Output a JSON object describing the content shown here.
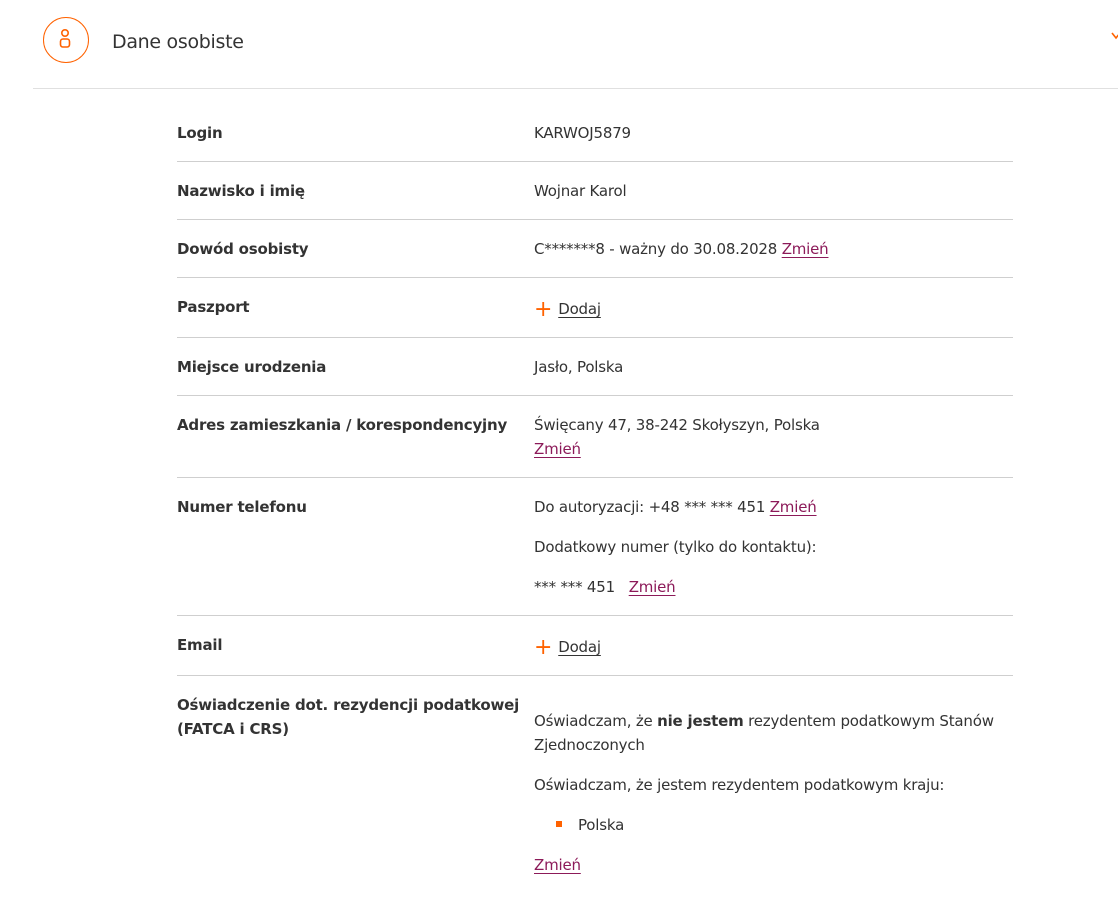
{
  "header": {
    "title": "Dane osobiste",
    "icon": "person-icon",
    "accent": "#ff6200"
  },
  "rows": {
    "login": {
      "label": "Login",
      "value": "KARWOJ5879"
    },
    "name": {
      "label": "Nazwisko i imię",
      "value": "Wojnar Karol"
    },
    "id_card": {
      "label": "Dowód osobisty",
      "value": "C*******8 - ważny do 30.08.2028",
      "action": "Zmień"
    },
    "passport": {
      "label": "Paszport",
      "action": "Dodaj"
    },
    "birthplace": {
      "label": "Miejsce urodzenia",
      "value": "Jasło, Polska"
    },
    "address": {
      "label": "Adres zamieszkania / korespondencyjny",
      "value": "Święcany 47, 38-242 Skołyszyn, Polska",
      "action": "Zmień"
    },
    "phone": {
      "label": "Numer telefonu",
      "auth_value": "Do autoryzacji: +48 *** *** 451",
      "auth_action": "Zmień",
      "extra_label": "Dodatkowy numer (tylko do kontaktu):",
      "extra_value": "*** *** 451",
      "extra_action": "Zmień"
    },
    "email": {
      "label": "Email",
      "action": "Dodaj"
    },
    "tax": {
      "label_line1": "Oświadczenie dot. rezydencji podatkowej",
      "label_line2": "(FATCA i CRS)",
      "us_prefix": "Oświadczam, że ",
      "us_bold": "nie jestem",
      "us_suffix": " rezydentem podatkowym Stanów",
      "us_line2": "Zjednoczonych",
      "country_intro": "Oświadczam, że jestem rezydentem podatkowym kraju:",
      "countries": [
        "Polska"
      ],
      "action": "Zmień"
    }
  },
  "colors": {
    "accent": "#ff6200",
    "link": "#8c1a59",
    "divider": "#cfcfcf"
  }
}
